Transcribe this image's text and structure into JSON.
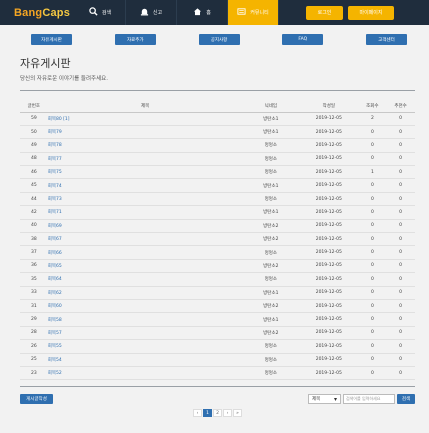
{
  "brand": {
    "logo_a": "Bang",
    "logo_b": "Caps"
  },
  "nav": [
    {
      "label": "검색",
      "icon": "search-icon"
    },
    {
      "label": "신고",
      "icon": "siren-icon"
    },
    {
      "label": "홈",
      "icon": "home-icon"
    },
    {
      "label": "커뮤니티",
      "icon": "community-icon",
      "active": true
    }
  ],
  "top_buttons": {
    "login": "로그인",
    "mypage": "마이페이지"
  },
  "subnav": [
    "자유게시판",
    "자료추가",
    "공지사항",
    "FAQ",
    "고객센터"
  ],
  "page": {
    "title": "자유게시판",
    "subtitle": "당신의 자유로운 이야기를 들려주세요."
  },
  "table": {
    "headers": [
      "글번호",
      "제목",
      "닉네임",
      "작성일",
      "조회수",
      "추천수"
    ],
    "rows": [
      [
        "59",
        "회목80 [1]",
        "방탄소1",
        "2019-12-05",
        "2",
        "0"
      ],
      [
        "50",
        "회목79",
        "방탄소1",
        "2019-12-05",
        "0",
        "0"
      ],
      [
        "49",
        "회목78",
        "멍멍소",
        "2019-12-05",
        "0",
        "0"
      ],
      [
        "48",
        "회목77",
        "멍멍소",
        "2019-12-05",
        "0",
        "0"
      ],
      [
        "46",
        "회목75",
        "멍멍소",
        "2019-12-05",
        "1",
        "0"
      ],
      [
        "45",
        "회목74",
        "방탄소1",
        "2019-12-05",
        "0",
        "0"
      ],
      [
        "44",
        "회목73",
        "멍멍소",
        "2019-12-05",
        "0",
        "0"
      ],
      [
        "42",
        "회목71",
        "방탄소1",
        "2019-12-05",
        "0",
        "0"
      ],
      [
        "40",
        "회목69",
        "방탄소2",
        "2019-12-05",
        "0",
        "0"
      ],
      [
        "38",
        "회목67",
        "방탄소2",
        "2019-12-05",
        "0",
        "0"
      ],
      [
        "37",
        "회목66",
        "멍멍소",
        "2019-12-05",
        "0",
        "0"
      ],
      [
        "36",
        "회목65",
        "방탄소2",
        "2019-12-05",
        "0",
        "0"
      ],
      [
        "35",
        "회목64",
        "멍멍소",
        "2019-12-05",
        "0",
        "0"
      ],
      [
        "33",
        "회목62",
        "방탄소1",
        "2019-12-05",
        "0",
        "0"
      ],
      [
        "31",
        "회목60",
        "방탄소2",
        "2019-12-05",
        "0",
        "0"
      ],
      [
        "29",
        "회목58",
        "방탄소1",
        "2019-12-05",
        "0",
        "0"
      ],
      [
        "28",
        "회목57",
        "방탄소2",
        "2019-12-05",
        "0",
        "0"
      ],
      [
        "26",
        "회목55",
        "멍멍소",
        "2019-12-05",
        "0",
        "0"
      ],
      [
        "25",
        "회목54",
        "멍멍소",
        "2019-12-05",
        "0",
        "0"
      ],
      [
        "23",
        "회목52",
        "멍멍소",
        "2019-12-05",
        "0",
        "0"
      ]
    ]
  },
  "actions": {
    "write": "게시글작성",
    "search_select": "제목",
    "search_placeholder": "검색어를 입력하세요",
    "search_button": "검색"
  },
  "pagination": [
    "‹",
    "1",
    "2",
    "›",
    "»"
  ],
  "colors": {
    "nav_bg": "#1f2d3d",
    "accent": "#f5b400",
    "primary": "#2f6fb0"
  }
}
